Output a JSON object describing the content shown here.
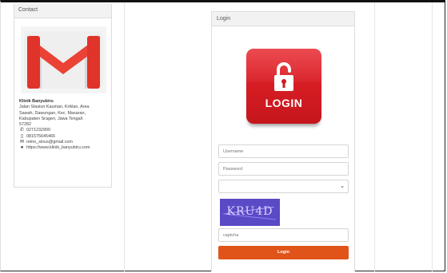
{
  "contact": {
    "title": "Contact",
    "icon": "gmail-icon",
    "name": "Klinik Banyubiru",
    "address_lines": [
      "Jalan Stasiun Kauman, Kriklan, Area",
      "Sawah, Dawungan, Kec. Masaran,",
      "Kabupaten Sragen, Jawa Tengah",
      "57282"
    ],
    "phone": "0271232900",
    "mobile": "081575645466",
    "email": "retno_sinus@gmail.com",
    "website": "https://www.klinik_banyubiru.com"
  },
  "login": {
    "title": "Login",
    "badge_text": "LOGIN",
    "username_placeholder": "Username",
    "password_placeholder": "Password",
    "select_value": "",
    "captcha_text": "KRU4D",
    "captcha_placeholder": "captcha",
    "submit_label": "Login"
  },
  "colors": {
    "accent": "#e0541a",
    "badge": "#e8232b",
    "captcha_bg": "#5b4ac6"
  }
}
